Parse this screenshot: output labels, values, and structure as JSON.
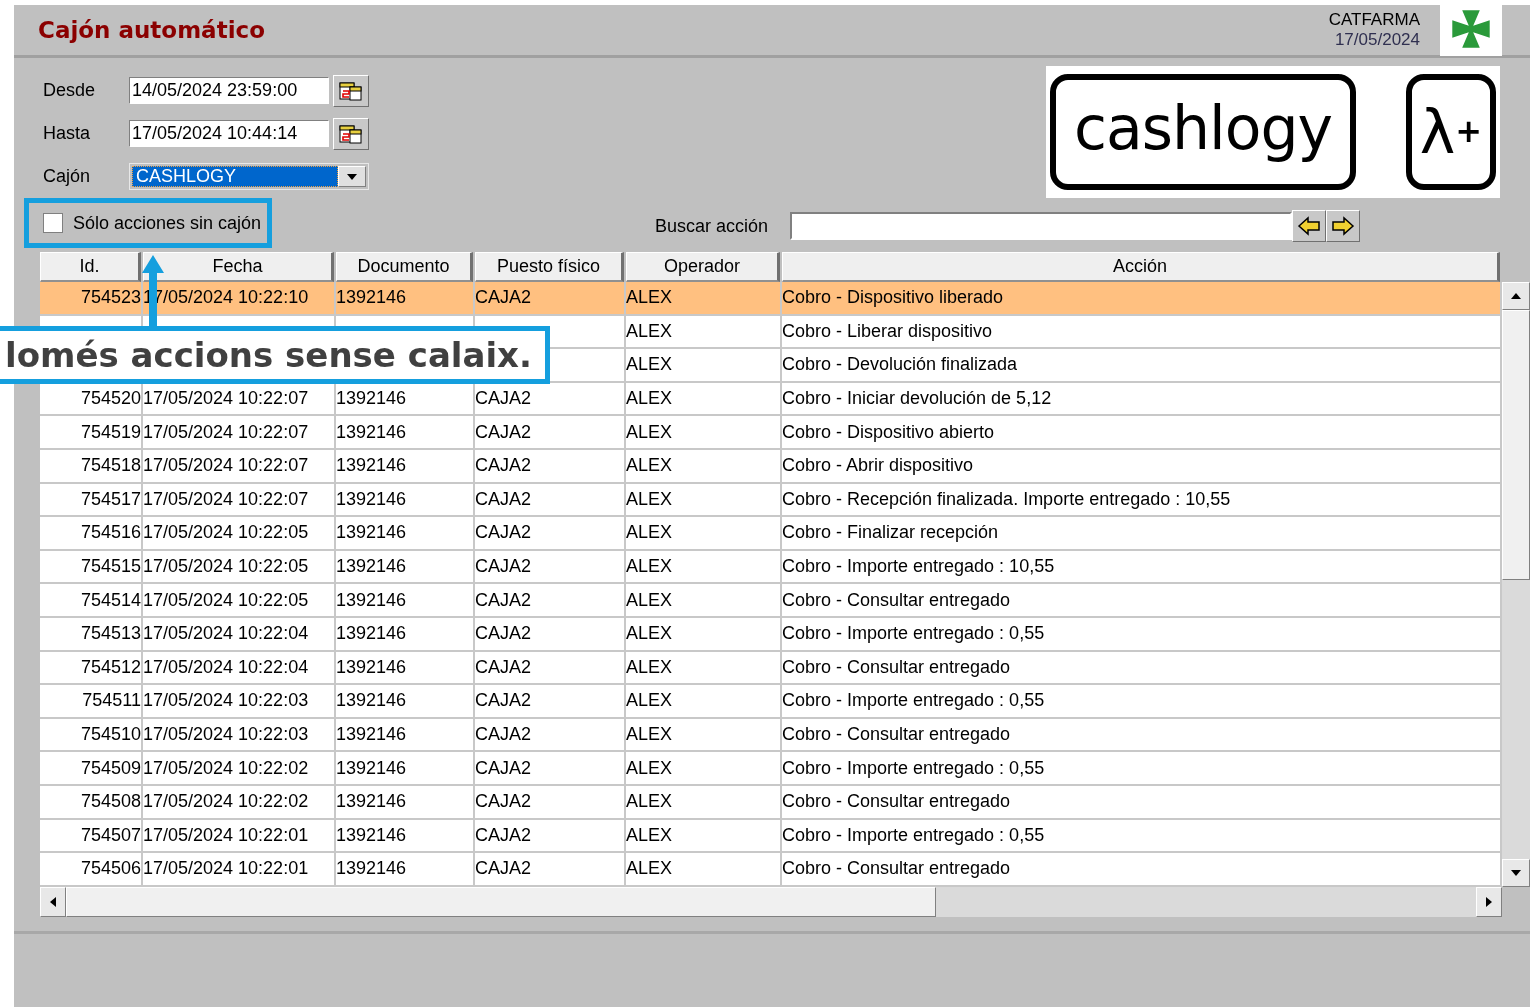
{
  "window": {
    "title": "Cajón automático"
  },
  "header": {
    "company": "CATFARMA",
    "date": "17/05/2024"
  },
  "filters": [
    {
      "label": "Desde",
      "kind": "date",
      "value": "14/05/2024 23:59:00"
    },
    {
      "label": "Hasta",
      "kind": "date",
      "value": "17/05/2024 10:44:14"
    },
    {
      "label": "Cajón",
      "kind": "select",
      "value": "CASHLOGY"
    }
  ],
  "only_without_drawer": {
    "label": "Sólo acciones sin cajón",
    "checked": false
  },
  "search": {
    "label": "Buscar acción"
  },
  "logos": {
    "brand": "cashlogy",
    "mark": "λ$^{+}$"
  },
  "table": {
    "columns": [
      "Id.",
      "Fecha",
      "Documento",
      "Puesto físico",
      "Operador",
      "Acción"
    ],
    "rows": [
      {
        "cells": [
          "754523",
          "17/05/2024 10:22:10",
          "1392146",
          "CAJA2",
          "ALEX",
          "Cobro - Dispositivo liberado"
        ],
        "selected": true
      },
      {
        "cells": [
          "",
          "",
          "",
          "",
          "ALEX",
          "Cobro - Liberar dispositivo"
        ],
        "selected": false
      },
      {
        "cells": [
          "",
          "",
          "",
          "",
          "ALEX",
          "Cobro - Devolución finalizada"
        ],
        "selected": false
      },
      {
        "cells": [
          "754520",
          "17/05/2024 10:22:07",
          "1392146",
          "CAJA2",
          "ALEX",
          "Cobro - Iniciar devolución de 5,12"
        ],
        "selected": false
      },
      {
        "cells": [
          "754519",
          "17/05/2024 10:22:07",
          "1392146",
          "CAJA2",
          "ALEX",
          "Cobro - Dispositivo abierto"
        ],
        "selected": false
      },
      {
        "cells": [
          "754518",
          "17/05/2024 10:22:07",
          "1392146",
          "CAJA2",
          "ALEX",
          "Cobro - Abrir dispositivo"
        ],
        "selected": false
      },
      {
        "cells": [
          "754517",
          "17/05/2024 10:22:07",
          "1392146",
          "CAJA2",
          "ALEX",
          "Cobro - Recepción finalizada. Importe entregado : 10,55"
        ],
        "selected": false
      },
      {
        "cells": [
          "754516",
          "17/05/2024 10:22:05",
          "1392146",
          "CAJA2",
          "ALEX",
          "Cobro - Finalizar recepción"
        ],
        "selected": false
      },
      {
        "cells": [
          "754515",
          "17/05/2024 10:22:05",
          "1392146",
          "CAJA2",
          "ALEX",
          "Cobro - Importe entregado : 10,55"
        ],
        "selected": false
      },
      {
        "cells": [
          "754514",
          "17/05/2024 10:22:05",
          "1392146",
          "CAJA2",
          "ALEX",
          "Cobro - Consultar entregado"
        ],
        "selected": false
      },
      {
        "cells": [
          "754513",
          "17/05/2024 10:22:04",
          "1392146",
          "CAJA2",
          "ALEX",
          "Cobro - Importe entregado : 0,55"
        ],
        "selected": false
      },
      {
        "cells": [
          "754512",
          "17/05/2024 10:22:04",
          "1392146",
          "CAJA2",
          "ALEX",
          "Cobro - Consultar entregado"
        ],
        "selected": false
      },
      {
        "cells": [
          "754511",
          "17/05/2024 10:22:03",
          "1392146",
          "CAJA2",
          "ALEX",
          "Cobro - Importe entregado : 0,55"
        ],
        "selected": false
      },
      {
        "cells": [
          "754510",
          "17/05/2024 10:22:03",
          "1392146",
          "CAJA2",
          "ALEX",
          "Cobro - Consultar entregado"
        ],
        "selected": false
      },
      {
        "cells": [
          "754509",
          "17/05/2024 10:22:02",
          "1392146",
          "CAJA2",
          "ALEX",
          "Cobro - Importe entregado : 0,55"
        ],
        "selected": false
      },
      {
        "cells": [
          "754508",
          "17/05/2024 10:22:02",
          "1392146",
          "CAJA2",
          "ALEX",
          "Cobro - Consultar entregado"
        ],
        "selected": false
      },
      {
        "cells": [
          "754507",
          "17/05/2024 10:22:01",
          "1392146",
          "CAJA2",
          "ALEX",
          "Cobro - Importe entregado : 0,55"
        ],
        "selected": false
      },
      {
        "cells": [
          "754506",
          "17/05/2024 10:22:01",
          "1392146",
          "CAJA2",
          "ALEX",
          "Cobro - Consultar entregado"
        ],
        "selected": false
      }
    ]
  },
  "callout": {
    "text": "lomés accions sense calaix."
  }
}
